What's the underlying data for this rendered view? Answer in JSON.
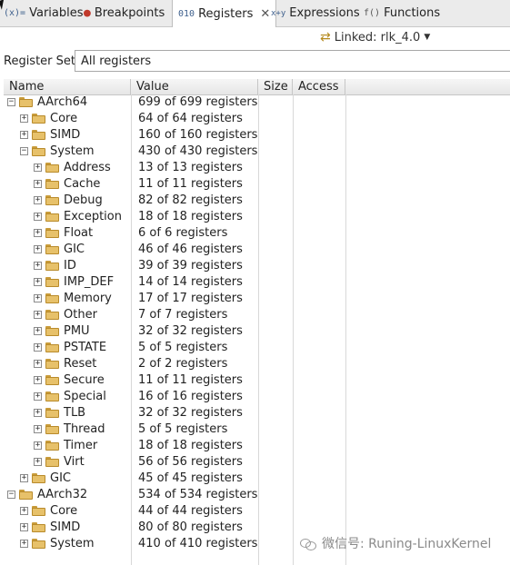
{
  "tabs": [
    {
      "label": "Variables",
      "icon": "variables-icon",
      "glyph": "(x)=",
      "active": false
    },
    {
      "label": "Breakpoints",
      "icon": "breakpoints-icon",
      "glyph": "●",
      "active": false
    },
    {
      "label": "Registers",
      "icon": "registers-icon",
      "glyph": "010",
      "active": true
    },
    {
      "label": "Expressions",
      "icon": "expressions-icon",
      "glyph": "x+y",
      "active": false
    },
    {
      "label": "Functions",
      "icon": "functions-icon",
      "glyph": "f()",
      "active": false
    }
  ],
  "linked": {
    "label": "Linked: rlk_4.0"
  },
  "register_set": {
    "label": "Register Set:",
    "value": "All registers"
  },
  "columns": {
    "name": "Name",
    "value": "Value",
    "size": "Size",
    "access": "Access"
  },
  "rows": [
    {
      "name": "AArch64",
      "value": "699 of 699 registers",
      "level": 0,
      "expanded": true
    },
    {
      "name": "Core",
      "value": "64 of 64 registers",
      "level": 1,
      "expanded": false
    },
    {
      "name": "SIMD",
      "value": "160 of 160 registers",
      "level": 1,
      "expanded": false
    },
    {
      "name": "System",
      "value": "430 of 430 registers",
      "level": 1,
      "expanded": true
    },
    {
      "name": "Address",
      "value": "13 of 13 registers",
      "level": 2,
      "expanded": false
    },
    {
      "name": "Cache",
      "value": "11 of 11 registers",
      "level": 2,
      "expanded": false
    },
    {
      "name": "Debug",
      "value": "82 of 82 registers",
      "level": 2,
      "expanded": false
    },
    {
      "name": "Exception",
      "value": "18 of 18 registers",
      "level": 2,
      "expanded": false
    },
    {
      "name": "Float",
      "value": "6 of 6 registers",
      "level": 2,
      "expanded": false
    },
    {
      "name": "GIC",
      "value": "46 of 46 registers",
      "level": 2,
      "expanded": false
    },
    {
      "name": "ID",
      "value": "39 of 39 registers",
      "level": 2,
      "expanded": false
    },
    {
      "name": "IMP_DEF",
      "value": "14 of 14 registers",
      "level": 2,
      "expanded": false
    },
    {
      "name": "Memory",
      "value": "17 of 17 registers",
      "level": 2,
      "expanded": false
    },
    {
      "name": "Other",
      "value": "7 of 7 registers",
      "level": 2,
      "expanded": false
    },
    {
      "name": "PMU",
      "value": "32 of 32 registers",
      "level": 2,
      "expanded": false
    },
    {
      "name": "PSTATE",
      "value": "5 of 5 registers",
      "level": 2,
      "expanded": false
    },
    {
      "name": "Reset",
      "value": "2 of 2 registers",
      "level": 2,
      "expanded": false
    },
    {
      "name": "Secure",
      "value": "11 of 11 registers",
      "level": 2,
      "expanded": false
    },
    {
      "name": "Special",
      "value": "16 of 16 registers",
      "level": 2,
      "expanded": false
    },
    {
      "name": "TLB",
      "value": "32 of 32 registers",
      "level": 2,
      "expanded": false
    },
    {
      "name": "Thread",
      "value": "5 of 5 registers",
      "level": 2,
      "expanded": false
    },
    {
      "name": "Timer",
      "value": "18 of 18 registers",
      "level": 2,
      "expanded": false
    },
    {
      "name": "Virt",
      "value": "56 of 56 registers",
      "level": 2,
      "expanded": false
    },
    {
      "name": "GIC",
      "value": "45 of 45 registers",
      "level": 1,
      "expanded": false
    },
    {
      "name": "AArch32",
      "value": "534 of 534 registers",
      "level": 0,
      "expanded": true
    },
    {
      "name": "Core",
      "value": "44 of 44 registers",
      "level": 1,
      "expanded": false
    },
    {
      "name": "SIMD",
      "value": "80 of 80 registers",
      "level": 1,
      "expanded": false
    },
    {
      "name": "System",
      "value": "410 of 410 registers",
      "level": 1,
      "expanded": false
    }
  ],
  "watermark": {
    "text": "微信号: Runing-LinuxKernel"
  }
}
